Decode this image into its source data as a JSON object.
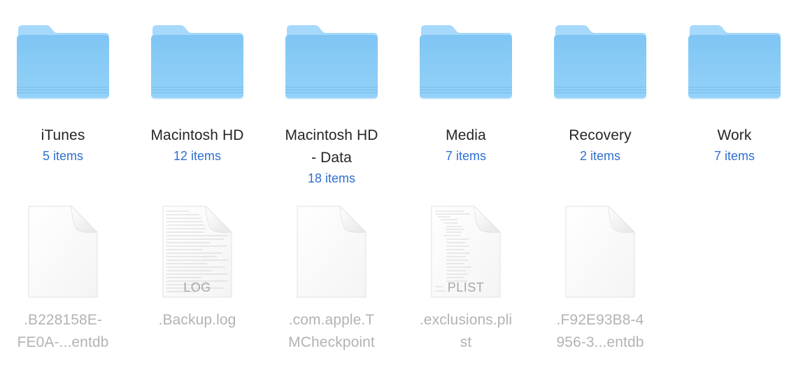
{
  "colors": {
    "folder_front": "#8ccdf6",
    "folder_back": "#a8dafb",
    "item_count": "#2f6fd1",
    "folder_name": "#262626",
    "hidden_file_name": "#b3b3b3"
  },
  "folders": [
    {
      "name": "iTunes",
      "count": "5 items",
      "icon": "folder-icon"
    },
    {
      "name": "Macintosh HD",
      "count": "12 items",
      "icon": "folder-icon"
    },
    {
      "name": "Macintosh HD\n- Data",
      "name_line1": "Macintosh HD",
      "name_line2": "- Data",
      "count": "18 items",
      "icon": "folder-icon"
    },
    {
      "name": "Media",
      "count": "7 items",
      "icon": "folder-icon"
    },
    {
      "name": "Recovery",
      "count": "2 items",
      "icon": "folder-icon"
    },
    {
      "name": "Work",
      "count": "7 items",
      "icon": "folder-icon"
    }
  ],
  "files": [
    {
      "name_line1": ".B228158E-",
      "name_line2": "FE0A-...entdb",
      "icon": "blank-document-icon",
      "badge": ""
    },
    {
      "name_line1": ".Backup.log",
      "name_line2": "",
      "icon": "log-document-icon",
      "badge": "LOG"
    },
    {
      "name_line1": ".com.apple.T",
      "name_line2": "MCheckpoint",
      "icon": "blank-document-icon",
      "badge": ""
    },
    {
      "name_line1": ".exclusions.pli",
      "name_line2": "st",
      "icon": "plist-document-icon",
      "badge": "PLIST"
    },
    {
      "name_line1": ".F92E93B8-4",
      "name_line2": "956-3...entdb",
      "icon": "blank-document-icon",
      "badge": ""
    }
  ]
}
